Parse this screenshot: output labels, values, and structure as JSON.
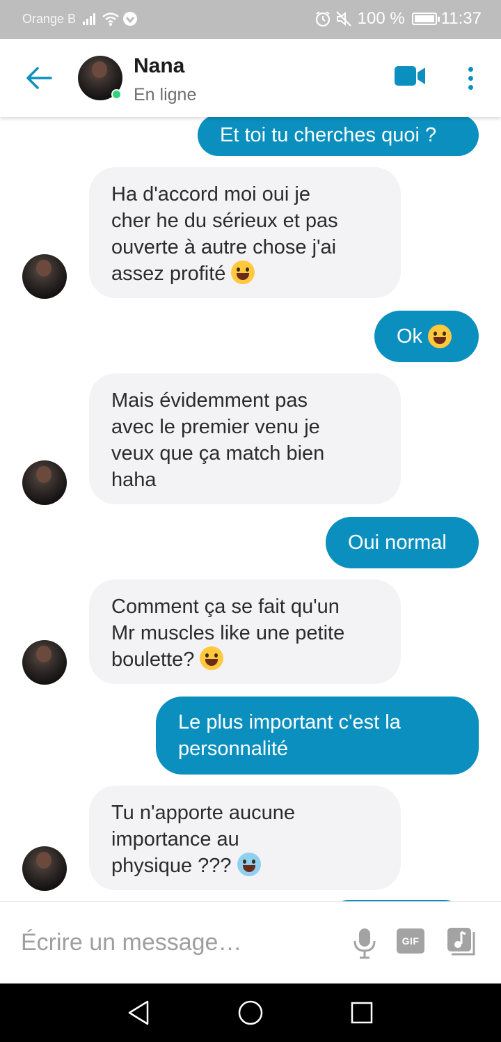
{
  "status_bar": {
    "carrier": "Orange B",
    "battery": "100 %",
    "time": "11:37"
  },
  "header": {
    "contact_name": "Nana",
    "contact_status": "En ligne",
    "icons": [
      "back-arrow-icon",
      "video-camera-icon",
      "more-vertical-icon"
    ],
    "accent_color": "#0a8fbf",
    "online_color": "#2ed47a"
  },
  "messages": [
    {
      "direction": "sent",
      "text": "Et toi tu cherches quoi ?"
    },
    {
      "direction": "received",
      "lines": [
        "Ha d'accord moi oui je",
        "cher he du sérieux et pas",
        "ouverte à autre chose j'ai",
        "assez profité"
      ],
      "emoji": "grinning-sweat-emoji"
    },
    {
      "direction": "sent",
      "text": "Ok",
      "emoji": "grinning-sweat-emoji"
    },
    {
      "direction": "received",
      "lines": [
        "Mais évidemment pas",
        "avec le premier venu je",
        "veux que ça match bien",
        "haha"
      ]
    },
    {
      "direction": "sent",
      "text": "Oui normal"
    },
    {
      "direction": "received",
      "lines": [
        "Comment ça se fait qu'un",
        "Mr muscles like une petite",
        "boulette?"
      ],
      "emoji": "winking-tongue-emoji"
    },
    {
      "direction": "sent",
      "lines": [
        "Le plus important c'est la",
        "personnalité"
      ]
    },
    {
      "direction": "received",
      "lines": [
        "Tu n'apporte aucune",
        "importance au",
        "physique ???"
      ],
      "emoji": "screaming-fear-emoji"
    }
  ],
  "colors": {
    "sent_bubble": "#0a8fbf",
    "received_bubble": "#f3f3f5"
  },
  "composer": {
    "placeholder": "Écrire un message…",
    "gif_label": "GIF",
    "icons": [
      "microphone-icon",
      "gif-icon",
      "music-icon"
    ]
  },
  "nav_bar": {
    "icons": [
      "nav-back-icon",
      "nav-home-icon",
      "nav-recent-icon"
    ]
  }
}
